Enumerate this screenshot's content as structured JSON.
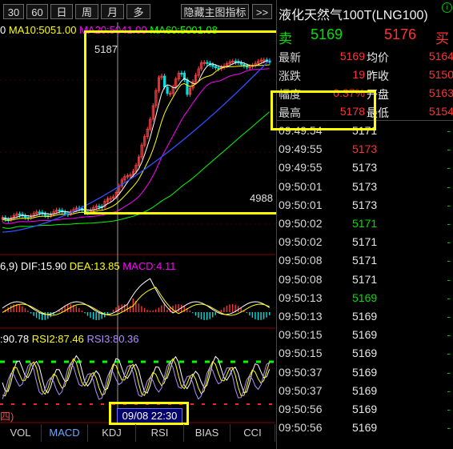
{
  "toolbar": {
    "buttons": [
      "30",
      "60",
      "日",
      "周",
      "月",
      "多"
    ],
    "hide_indicator_label": "隐藏主图指标",
    "more_label": ">>"
  },
  "main_chart": {
    "ma_labels": [
      {
        "text": "0",
        "color": "#ffffff"
      },
      {
        "text": "MA10:5051.00",
        "color": "#ffff00"
      },
      {
        "text": "MA20:5041.00",
        "color": "#ff00ff"
      },
      {
        "text": "MA60:5001.08",
        "color": "#00ff00"
      }
    ],
    "high_marker": "5187",
    "low_marker": "4988"
  },
  "macd": {
    "labels": [
      {
        "text": "6,9)",
        "color": "#ffffff"
      },
      {
        "text": "DIF:15.90",
        "color": "#ffffff"
      },
      {
        "text": "DEA:13.85",
        "color": "#ffff00"
      },
      {
        "text": "MACD:4.11",
        "color": "#ff00ff"
      }
    ]
  },
  "rsi": {
    "labels": [
      {
        "text": ":90.78",
        "color": "#ffffff"
      },
      {
        "text": "RSI2:87.46",
        "color": "#ffff00"
      },
      {
        "text": "RSI3:80.36",
        "color": "#b090ff"
      }
    ]
  },
  "date_cursor": "09/08 22:30",
  "weekday_fragment": "四)",
  "bottom_tabs": [
    "VOL",
    "MACD",
    "KDJ",
    "RSI",
    "BIAS",
    "CCI"
  ],
  "active_tab": "MACD",
  "quote": {
    "title": "液化天然气100T(LNG100)",
    "ask_label": "卖",
    "ask_price": "5169",
    "bid_price": "5176",
    "bid_label": "买",
    "rows": [
      {
        "l1": "最新",
        "v1": "5169",
        "l2": "均价",
        "v2": "5164"
      },
      {
        "l1": "涨跌",
        "v1": "19",
        "l2": "昨收",
        "v2": "5150"
      },
      {
        "l1": "幅度",
        "v1": "0.37%",
        "l2": "开盘",
        "v2": "5163"
      },
      {
        "l1": "最高",
        "v1": "5178",
        "l2": "最低",
        "v2": "5154"
      }
    ]
  },
  "ticks": [
    {
      "time": "09:49:54",
      "price": "5171",
      "color": "white"
    },
    {
      "time": "09:49:55",
      "price": "5173",
      "color": "red"
    },
    {
      "time": "09:49:55",
      "price": "5173",
      "color": "white"
    },
    {
      "time": "09:50:01",
      "price": "5173",
      "color": "white"
    },
    {
      "time": "09:50:01",
      "price": "5173",
      "color": "white"
    },
    {
      "time": "09:50:02",
      "price": "5171",
      "color": "green"
    },
    {
      "time": "09:50:02",
      "price": "5171",
      "color": "white"
    },
    {
      "time": "09:50:08",
      "price": "5171",
      "color": "white"
    },
    {
      "time": "09:50:08",
      "price": "5171",
      "color": "white"
    },
    {
      "time": "09:50:13",
      "price": "5169",
      "color": "green"
    },
    {
      "time": "09:50:13",
      "price": "5169",
      "color": "white"
    },
    {
      "time": "09:50:15",
      "price": "5169",
      "color": "white"
    },
    {
      "time": "09:50:15",
      "price": "5169",
      "color": "white"
    },
    {
      "time": "09:50:37",
      "price": "5169",
      "color": "white"
    },
    {
      "time": "09:50:37",
      "price": "5169",
      "color": "white"
    },
    {
      "time": "09:50:56",
      "price": "5169",
      "color": "white"
    },
    {
      "time": "09:50:56",
      "price": "5169",
      "color": "white"
    }
  ],
  "tick_marker": "-"
}
